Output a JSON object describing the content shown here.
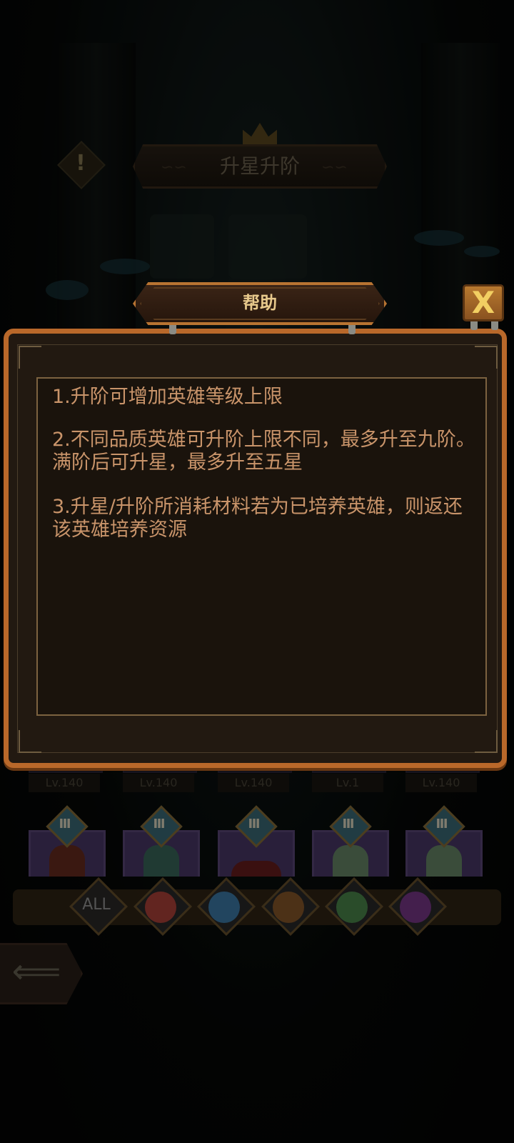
{
  "header": {
    "title": "升星升阶"
  },
  "hero_levels": [
    "Lv.140",
    "Lv.140",
    "Lv.140",
    "Lv.1",
    "Lv.140"
  ],
  "hero_rank_glyphs": [
    "Ⅲ",
    "Ⅲ",
    "Ⅲ",
    "Ⅲ",
    "Ⅲ"
  ],
  "filters": {
    "all_label": "ALL"
  },
  "help_dialog": {
    "title": "帮助",
    "close_glyph": "X",
    "lines": [
      "1.升阶可增加英雄等级上限",
      "2.不同品质英雄可升阶上限不同，最多升至九阶。满阶后可升星，最多升至五星",
      "3.升星/升阶所消耗材料若为已培养英雄，则返还该英雄培养资源"
    ]
  },
  "colors": {
    "panel_border": "#b9682a",
    "help_text": "#c9946a",
    "help_title": "#e8c98c",
    "close_icon": "#f2cf62"
  }
}
